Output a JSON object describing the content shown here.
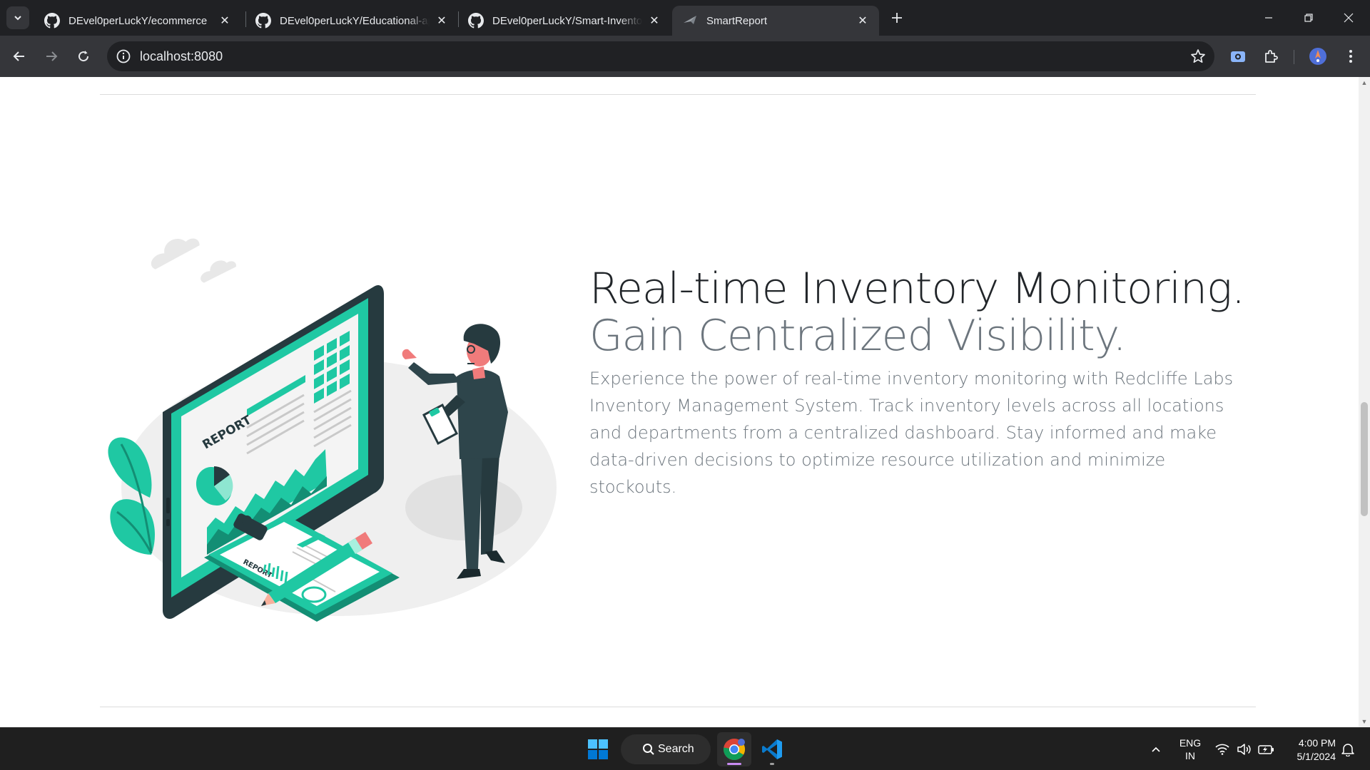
{
  "browser": {
    "tabs": [
      {
        "title": "DEvel0perLuckY/ecommerce",
        "icon": "github-icon",
        "active": false
      },
      {
        "title": "DEvel0perLuckY/Educational-ap",
        "icon": "github-icon",
        "active": false
      },
      {
        "title": "DEvel0perLuckY/Smart-Invento",
        "icon": "github-icon",
        "active": false
      },
      {
        "title": "SmartReport",
        "icon": "smartreport-favicon",
        "active": true
      }
    ],
    "address": "localhost:8080"
  },
  "section": {
    "headline_main": "Real-time Inventory Monitoring.",
    "headline_muted": "Gain Centralized Visibility.",
    "lead": "Experience the power of real-time inventory monitoring with Redcliffe Labs Inventory Management System. Track inventory levels across all locations and departments from a centralized dashboard. Stay informed and make data-driven decisions to optimize resource utilization and minimize stockouts.",
    "illustration": {
      "monitor_label": "REPORT",
      "clipboard_label": "REPORT",
      "accent_color": "#1fc8a3",
      "dark_color": "#263a3f"
    }
  },
  "taskbar": {
    "search_label": "Search",
    "language_line1": "ENG",
    "language_line2": "IN",
    "time": "4:00 PM",
    "date": "5/1/2024"
  }
}
